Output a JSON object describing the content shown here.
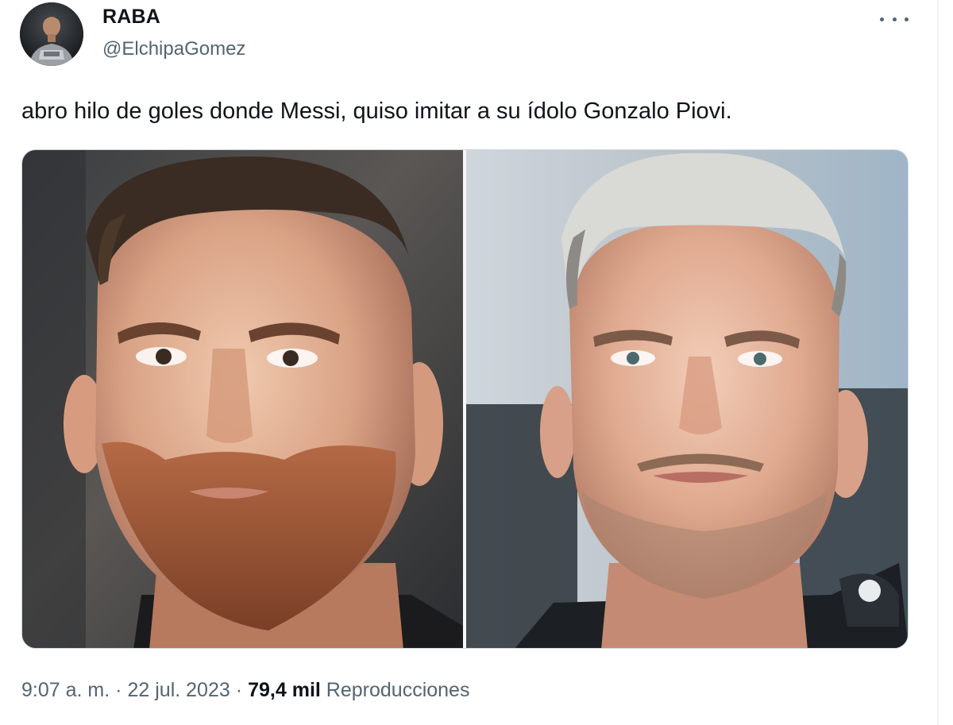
{
  "author": {
    "name": "RABA",
    "handle": "@ElchipaGomez",
    "avatar_icon": "profile-photo"
  },
  "more_icon": "more-horizontal-icon",
  "tweet": {
    "text": "abro hilo de goles donde Messi, quiso imitar a su ídolo Gonzalo Piovi."
  },
  "media": {
    "images": [
      {
        "subject": "portrait-left",
        "icon": "photo"
      },
      {
        "subject": "portrait-right",
        "icon": "photo"
      }
    ]
  },
  "meta": {
    "time": "9:07 a. m.",
    "separator": "·",
    "date": "22 jul. 2023",
    "views_count": "79,4 mil",
    "views_label": "Reproducciones"
  },
  "colors": {
    "text_primary": "#0f1419",
    "text_secondary": "#536471",
    "border": "#cfd9de"
  }
}
